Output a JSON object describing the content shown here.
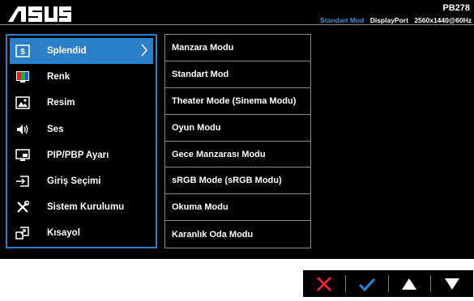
{
  "header": {
    "logo_text": "ASUS",
    "model": "PB278",
    "status_mode": "Standart Mod",
    "status_input": "DisplayPort",
    "status_resolution": "2560x1440@60Hz"
  },
  "main_menu": {
    "items": [
      {
        "label": "Splendid",
        "icon": "splendid-icon",
        "selected": true
      },
      {
        "label": "Renk",
        "icon": "color-icon",
        "selected": false
      },
      {
        "label": "Resim",
        "icon": "image-icon",
        "selected": false
      },
      {
        "label": "Ses",
        "icon": "speaker-icon",
        "selected": false
      },
      {
        "label": "PIP/PBP Ayarı",
        "icon": "pip-icon",
        "selected": false
      },
      {
        "label": "Giriş Seçimi",
        "icon": "input-icon",
        "selected": false
      },
      {
        "label": "Sistem Kurulumu",
        "icon": "tools-icon",
        "selected": false
      },
      {
        "label": "Kısayol",
        "icon": "shortcut-icon",
        "selected": false
      }
    ]
  },
  "sub_menu": {
    "items": [
      "Manzara Modu",
      "Standart Mod",
      "Theater Mode (Sinema Modu)",
      "Oyun Modu",
      "Gece Manzarası Modu",
      "sRGB Mode (sRGB Modu)",
      "Okuma Modu",
      "Karanlık Oda Modu"
    ]
  },
  "keys": [
    "close-x-icon",
    "check-icon",
    "up-triangle-icon",
    "down-triangle-icon"
  ],
  "colors": {
    "accent": "#2a7fc8",
    "status_mode": "#3a8fd6",
    "close_red": "#e8262a",
    "check_blue": "#2a87d6"
  }
}
